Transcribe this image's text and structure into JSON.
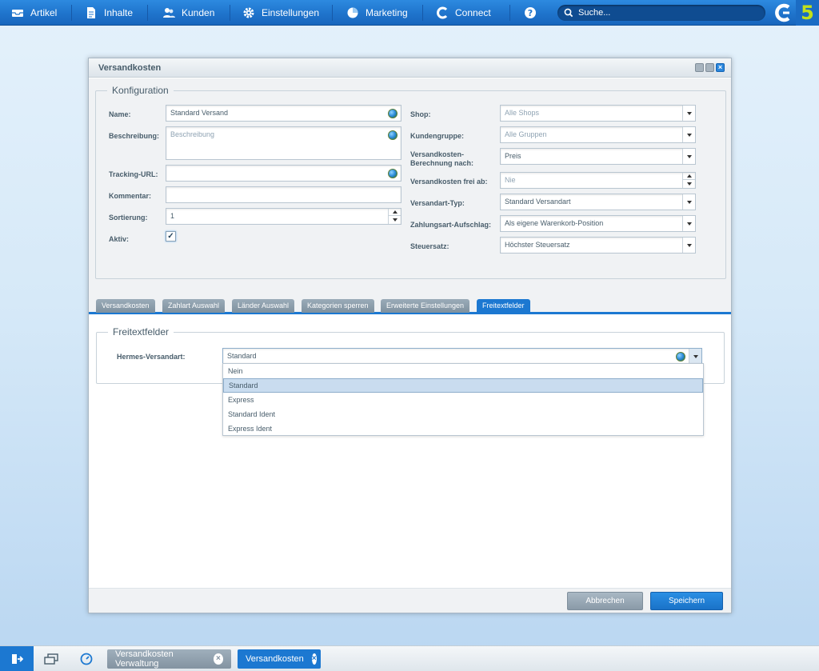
{
  "menu": {
    "items": [
      {
        "label": "Artikel",
        "icon": "tray-icon"
      },
      {
        "label": "Inhalte",
        "icon": "document-icon"
      },
      {
        "label": "Kunden",
        "icon": "users-icon"
      },
      {
        "label": "Einstellungen",
        "icon": "gear-icon"
      },
      {
        "label": "Marketing",
        "icon": "pie-chart-icon"
      },
      {
        "label": "Connect",
        "icon": "connect-icon"
      }
    ],
    "help_icon": "question-icon",
    "search_placeholder": "Suche...",
    "logo_version": "5",
    "accent_color": "#1f74cc"
  },
  "window": {
    "title": "Versandkosten",
    "config_legend": "Konfiguration",
    "left": {
      "name_label": "Name:",
      "name_value": "Standard Versand",
      "description_label": "Beschreibung:",
      "description_placeholder": "Beschreibung",
      "tracking_label": "Tracking-URL:",
      "tracking_value": "",
      "comment_label": "Kommentar:",
      "comment_value": "",
      "sort_label": "Sortierung:",
      "sort_value": "1",
      "active_label": "Aktiv:",
      "active_checked": "✓"
    },
    "right": {
      "shop_label": "Shop:",
      "shop_value": "Alle Shops",
      "group_label": "Kundengruppe:",
      "group_value": "Alle Gruppen",
      "calc_label_1": "Versandkosten-",
      "calc_label_2": "Berechnung nach:",
      "calc_value": "Preis",
      "free_label": "Versandkosten frei ab:",
      "free_value": "Nie",
      "type_label": "Versandart-Typ:",
      "type_value": "Standard Versandart",
      "surcharge_label": "Zahlungsart-Aufschlag:",
      "surcharge_value": "Als eigene Warenkorb-Position",
      "tax_label": "Steuersatz:",
      "tax_value": "Höchster Steuersatz"
    },
    "tabs": [
      {
        "label": "Versandkosten"
      },
      {
        "label": "Zahlart Auswahl"
      },
      {
        "label": "Länder Auswahl"
      },
      {
        "label": "Kategorien sperren"
      },
      {
        "label": "Erweiterte Einstellungen"
      },
      {
        "label": "Freitextfelder"
      }
    ],
    "freitext": {
      "legend": "Freitextfelder",
      "hermes_label": "Hermes-Versandart:",
      "hermes_value": "Standard",
      "options": [
        "Nein",
        "Standard",
        "Express",
        "Standard Ident",
        "Express Ident"
      ],
      "selected_option": "Standard"
    },
    "buttons": {
      "cancel": "Abbrechen",
      "save": "Speichern"
    }
  },
  "taskbar": {
    "tasks": [
      {
        "label": "Versandkosten Verwaltung",
        "active": false
      },
      {
        "label": "Versandkosten",
        "active": true
      }
    ]
  }
}
